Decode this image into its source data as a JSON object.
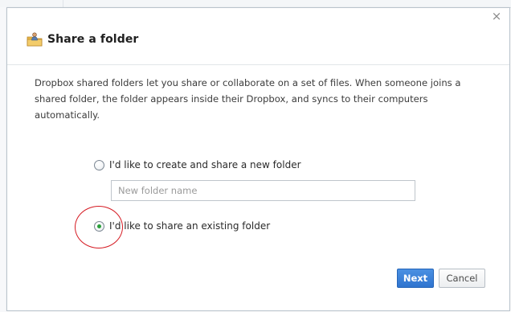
{
  "dialog": {
    "title": "Share a folder",
    "close_glyph": "×",
    "title_icon": "shared-folder-icon",
    "description": "Dropbox shared folders let you share or collaborate on a set of files. When someone joins a shared folder, the folder appears inside their Dropbox, and syncs to their computers automatically."
  },
  "options": {
    "create_label": "I'd like to create and share a new folder",
    "existing_label": "I'd like to share an existing folder",
    "selected": "existing"
  },
  "new_folder_input": {
    "value": "",
    "placeholder": "New folder name"
  },
  "buttons": {
    "next_label": "Next",
    "cancel_label": "Cancel"
  },
  "colors": {
    "primary_button": "#2f74cf",
    "annotation": "#d51a22",
    "radio_selected": "#2aa03a"
  }
}
